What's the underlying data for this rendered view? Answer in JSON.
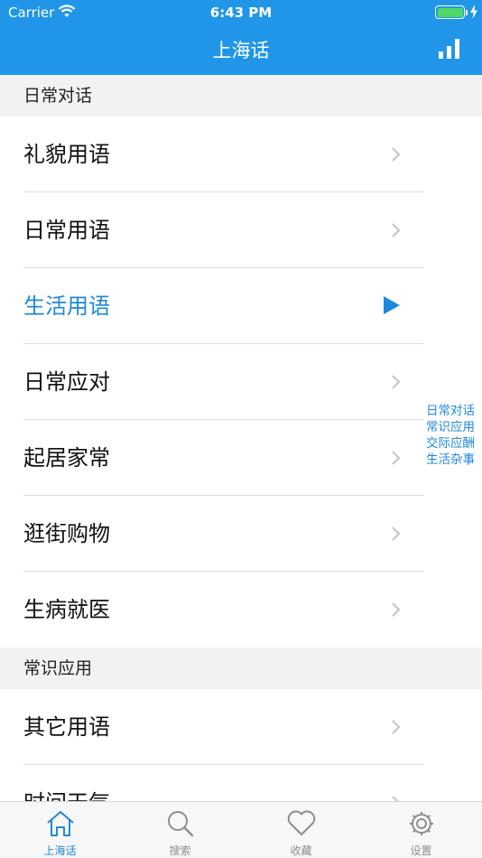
{
  "status_bar": {
    "carrier": "Carrier",
    "time": "6:43 PM"
  },
  "nav": {
    "title": "上海话",
    "right_icon": "bar-chart-icon"
  },
  "sections": [
    {
      "title": "日常对话",
      "items": [
        {
          "label": "礼貌用语",
          "state": "chevron"
        },
        {
          "label": "日常用语",
          "state": "chevron"
        },
        {
          "label": "生活用语",
          "state": "playing"
        },
        {
          "label": "日常应对",
          "state": "chevron"
        },
        {
          "label": "起居家常",
          "state": "chevron"
        },
        {
          "label": "逛街购物",
          "state": "chevron"
        },
        {
          "label": "生病就医",
          "state": "chevron"
        }
      ]
    },
    {
      "title": "常识应用",
      "items": [
        {
          "label": "其它用语",
          "state": "chevron"
        },
        {
          "label": "时间天气",
          "state": "chevron"
        }
      ]
    }
  ],
  "section_index": [
    "日常对话",
    "常识应用",
    "交际应酬",
    "生活杂事"
  ],
  "tabs": [
    {
      "label": "上海话",
      "icon": "home-icon",
      "active": true
    },
    {
      "label": "搜索",
      "icon": "search-icon",
      "active": false
    },
    {
      "label": "收藏",
      "icon": "heart-icon",
      "active": false
    },
    {
      "label": "设置",
      "icon": "gear-icon",
      "active": false
    }
  ],
  "colors": {
    "accent": "#2196e8",
    "active_text": "#1e88dc",
    "battery": "#4cd964"
  }
}
